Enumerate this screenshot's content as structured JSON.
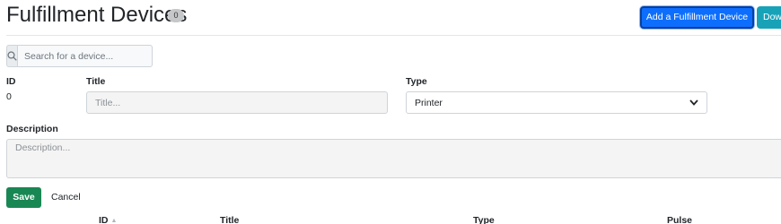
{
  "header": {
    "title": "Fulfillment Devices",
    "count": "0",
    "add_button_label": "Add a Fulfillment Device",
    "download_button_label": "Download"
  },
  "search": {
    "placeholder": "Search for a device...",
    "value": "",
    "icon": "search-icon"
  },
  "form": {
    "id_label": "ID",
    "id_value": "0",
    "title_label": "Title",
    "title_placeholder": "Title...",
    "type_label": "Type",
    "type_selected": "Printer",
    "description_label": "Description",
    "description_placeholder": "Description...",
    "save_label": "Save",
    "cancel_label": "Cancel"
  },
  "table": {
    "columns": [
      "ID",
      "Title",
      "Type",
      "Pulse"
    ]
  },
  "colors": {
    "primary": "#0d6efd",
    "info": "#17a2b8",
    "success": "#198754",
    "badge": "#c5c7c9"
  }
}
